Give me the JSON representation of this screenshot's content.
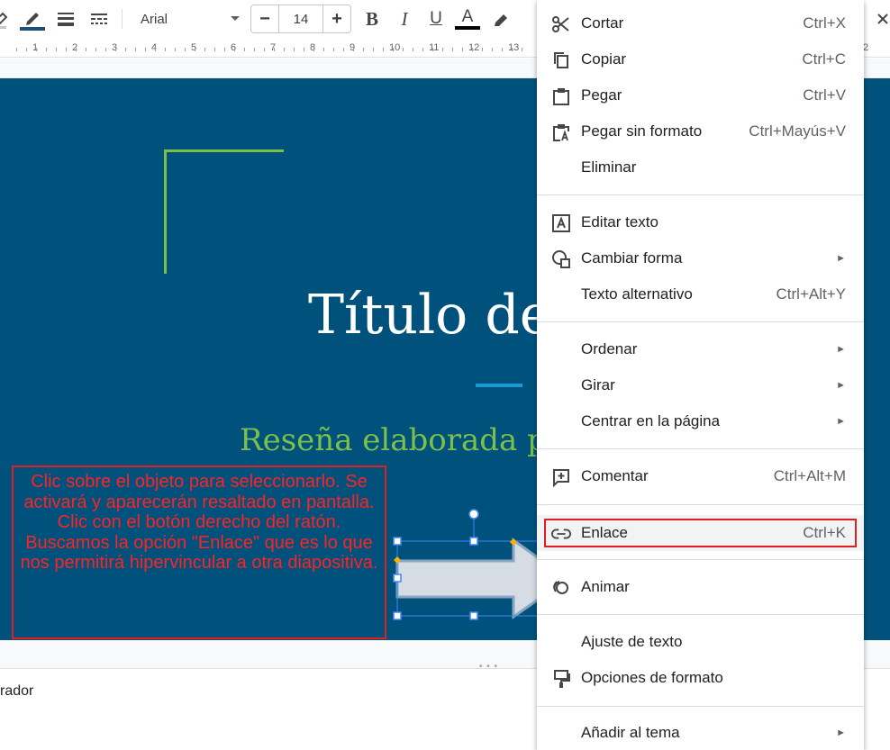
{
  "toolbar": {
    "font_name": "Arial",
    "font_size": "14",
    "minus": "−",
    "plus": "+",
    "bold": "B",
    "italic": "I",
    "underline": "U",
    "text_color": "A"
  },
  "ruler": {
    "numbers": [
      "1",
      "2",
      "3",
      "4",
      "5",
      "6",
      "7",
      "8",
      "9",
      "10",
      "11",
      "12",
      "13",
      "2"
    ]
  },
  "slide": {
    "title": "Título de",
    "subtitle": "Reseña elaborada p",
    "background": "#00527c",
    "accent_green": "#7cc049",
    "accent_blue": "#1a9ad6",
    "callout_text": "Clic sobre el objeto para seleccionarlo. Se activará y aparecerán resaltado en pantalla. Clic con el botón derecho del ratón. Buscamos la opción \"Enlace\" que es lo que nos permitirá hipervincular a otra diapositiva."
  },
  "notes": {
    "text": "rador"
  },
  "menu": {
    "cut": {
      "label": "Cortar",
      "shortcut": "Ctrl+X",
      "icon": "scissors-icon"
    },
    "copy": {
      "label": "Copiar",
      "shortcut": "Ctrl+C",
      "icon": "copy-icon"
    },
    "paste": {
      "label": "Pegar",
      "shortcut": "Ctrl+V",
      "icon": "clipboard-icon"
    },
    "paste_plain": {
      "label": "Pegar sin formato",
      "shortcut": "Ctrl+Mayús+V",
      "icon": "paste-plain-icon"
    },
    "delete": {
      "label": "Eliminar"
    },
    "edit_text": {
      "label": "Editar texto",
      "icon": "text-box-icon"
    },
    "change_shape": {
      "label": "Cambiar forma",
      "icon": "shapes-icon",
      "submenu": "►"
    },
    "alt_text": {
      "label": "Texto alternativo",
      "shortcut": "Ctrl+Alt+Y"
    },
    "order": {
      "label": "Ordenar",
      "submenu": "►"
    },
    "rotate": {
      "label": "Girar",
      "submenu": "►"
    },
    "center": {
      "label": "Centrar en la página",
      "submenu": "►"
    },
    "comment": {
      "label": "Comentar",
      "shortcut": "Ctrl+Alt+M",
      "icon": "comment-add-icon"
    },
    "link": {
      "label": "Enlace",
      "shortcut": "Ctrl+K",
      "icon": "link-icon"
    },
    "animate": {
      "label": "Animar",
      "icon": "animate-icon"
    },
    "text_fit": {
      "label": "Ajuste de texto"
    },
    "format_options": {
      "label": "Opciones de formato",
      "icon": "format-paint-icon"
    },
    "add_theme": {
      "label": "Añadir al tema",
      "submenu": "►"
    },
    "highlight_color": "#e02020"
  }
}
